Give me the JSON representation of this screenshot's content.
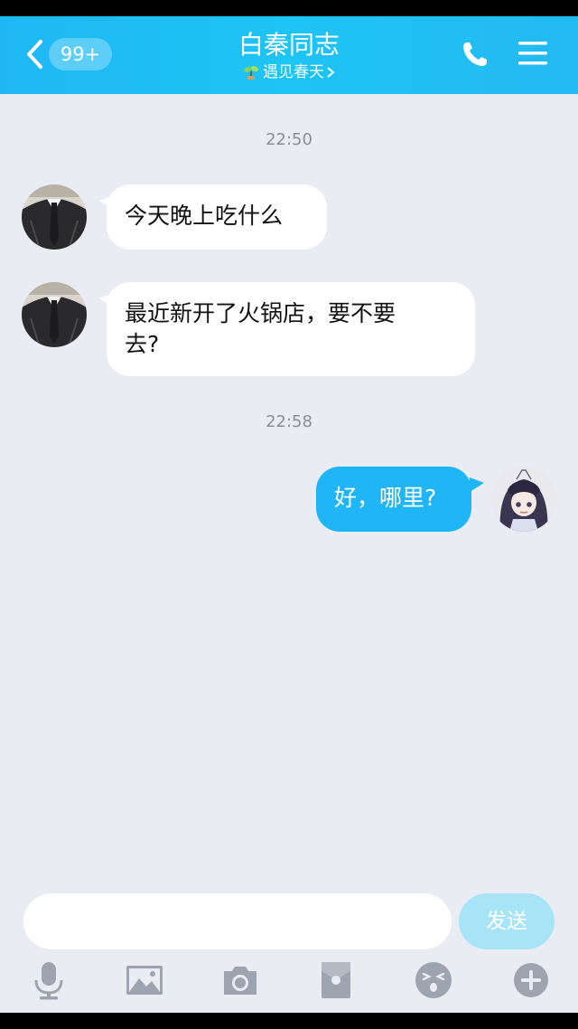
{
  "header": {
    "unread_badge": "99+",
    "title": "白秦同志",
    "subtitle": "遇见春天"
  },
  "messages": [
    {
      "type": "time",
      "text": "22:50"
    },
    {
      "type": "incoming",
      "text": "今天晚上吃什么"
    },
    {
      "type": "incoming",
      "text_line1": "最近新开了火锅店，要不要",
      "text_line2": "去?"
    },
    {
      "type": "time",
      "text": "22:58"
    },
    {
      "type": "outgoing",
      "text": "好，哪里?"
    }
  ],
  "composer": {
    "input_value": "",
    "send_label": "发送"
  },
  "toolbar": {
    "icons": [
      "microphone-icon",
      "image-icon",
      "camera-icon",
      "red-packet-icon",
      "emoji-icon",
      "plus-icon"
    ]
  },
  "colors": {
    "header": "#1ec4f3",
    "chat_bg": "#eaecf3",
    "outgoing_bubble": "#20b5f6",
    "send_button_disabled": "#a8e4f8"
  }
}
